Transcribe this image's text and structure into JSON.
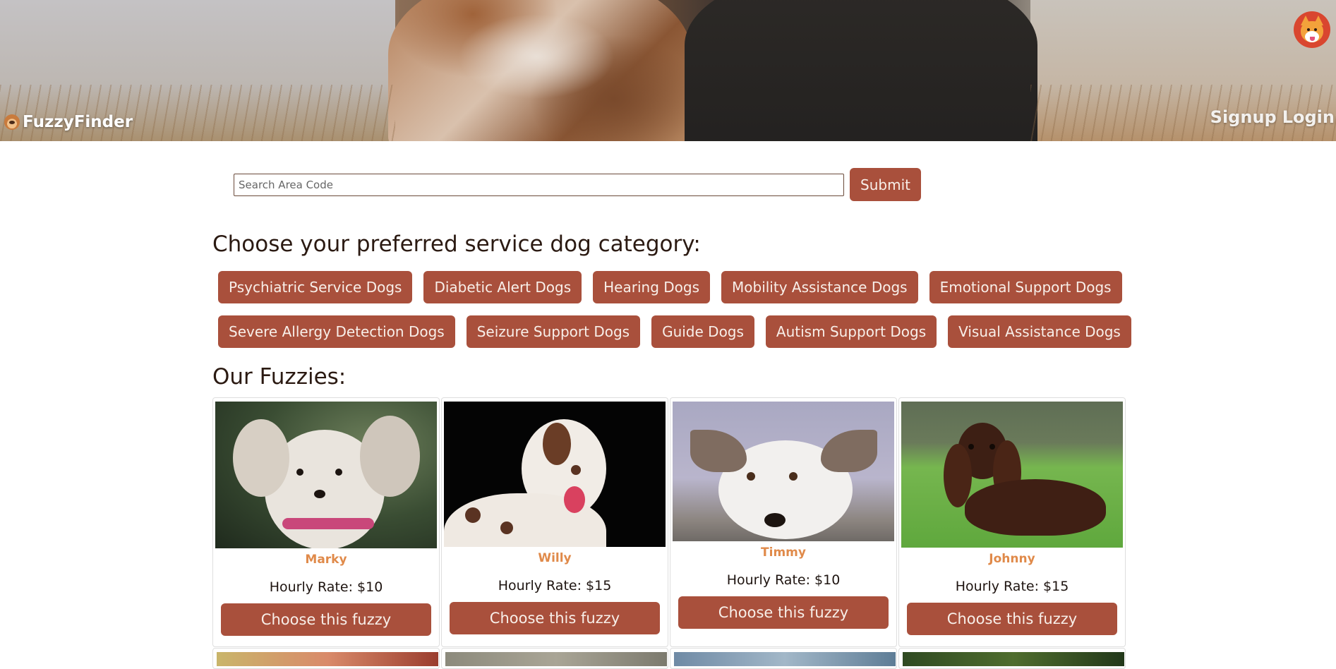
{
  "header": {
    "brand": "FuzzyFinder",
    "signup_label": "Signup",
    "login_label": "Login"
  },
  "search": {
    "placeholder": "Search Area Code",
    "submit_label": "Submit"
  },
  "categories": {
    "heading": "Choose your preferred service dog category:",
    "row1": [
      "Psychiatric Service Dogs",
      "Diabetic Alert Dogs",
      "Hearing Dogs",
      "Mobility Assistance Dogs",
      "Emotional Support Dogs"
    ],
    "row2": [
      "Severe Allergy Detection Dogs",
      "Seizure Support Dogs",
      "Guide Dogs",
      "Autism Support Dogs",
      "Visual Assistance Dogs"
    ]
  },
  "fuzzies": {
    "heading": "Our Fuzzies:",
    "cards": [
      {
        "name": "Marky",
        "rate": "Hourly Rate: $10",
        "button": "Choose this fuzzy"
      },
      {
        "name": "Willy",
        "rate": "Hourly Rate: $15",
        "button": "Choose this fuzzy"
      },
      {
        "name": "Timmy",
        "rate": "Hourly Rate: $10",
        "button": "Choose this fuzzy"
      },
      {
        "name": "Johnny",
        "rate": "Hourly Rate: $15",
        "button": "Choose this fuzzy"
      }
    ]
  },
  "colors": {
    "accent": "#a9503c",
    "dog_name": "#e08a4a"
  }
}
